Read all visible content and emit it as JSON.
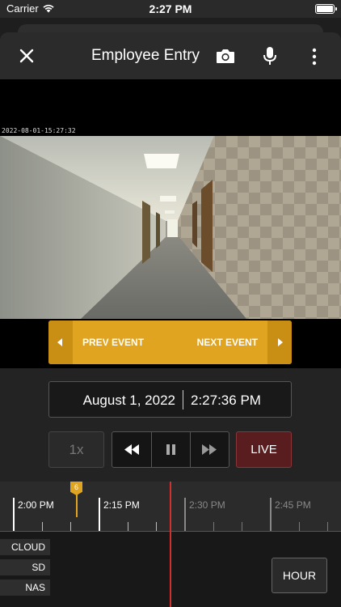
{
  "status_bar": {
    "carrier": "Carrier",
    "time": "2:27 PM"
  },
  "header": {
    "title": "Employee Entry",
    "icons": [
      "close-icon",
      "camera-icon",
      "microphone-icon",
      "more-vertical-icon"
    ]
  },
  "video": {
    "timestamp_overlay": "2022-08-01-15:27:32",
    "event_nav": {
      "prev_label": "PREV EVENT",
      "next_label": "NEXT EVENT"
    }
  },
  "playback": {
    "date": "August 1, 2022",
    "time": "2:27:36 PM",
    "speed_label": "1x",
    "live_label": "LIVE",
    "icons": [
      "rewind-icon",
      "pause-icon",
      "fast-forward-icon"
    ]
  },
  "timeline": {
    "labels": [
      "2:00 PM",
      "2:15 PM",
      "2:30 PM",
      "2:45 PM"
    ],
    "event_count": "6",
    "sources": [
      "CLOUD",
      "SD",
      "NAS"
    ],
    "zoom_label": "HOUR"
  },
  "colors": {
    "accent": "#e0a420",
    "live": "#5a1d1f",
    "playhead": "#d32f2f",
    "background": "#1e1e1e"
  }
}
